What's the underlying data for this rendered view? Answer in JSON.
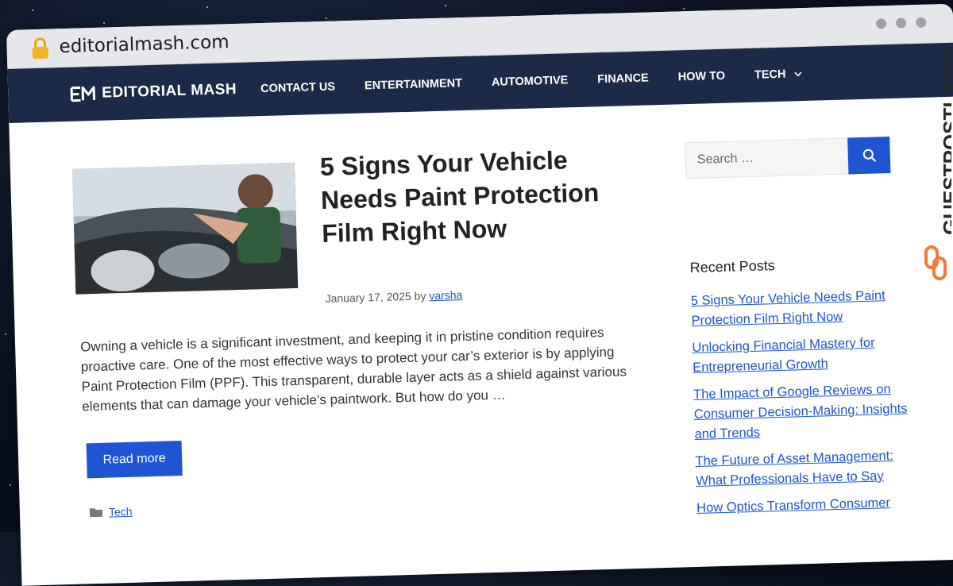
{
  "browser": {
    "url": "editorialmash.com"
  },
  "site": {
    "logo_text": "EDITORIAL MASH",
    "nav": [
      {
        "label": "CONTACT US"
      },
      {
        "label": "ENTERTAINMENT"
      },
      {
        "label": "AUTOMOTIVE"
      },
      {
        "label": "FINANCE"
      },
      {
        "label": "HOW TO"
      },
      {
        "label": "TECH",
        "has_dropdown": true
      }
    ]
  },
  "post": {
    "title": "5 Signs Your Vehicle Needs Paint Protection Film Right Now",
    "date": "January 17, 2025",
    "by": "by",
    "author": "varsha",
    "excerpt": "Owning a vehicle is a significant investment, and keeping it in pristine condition requires proactive care. One of the most effective ways to protect your car’s exterior is by applying Paint Protection Film (PPF). This transparent, durable layer acts as a shield against various elements that can damage your vehicle’s paintwork. But how do you …",
    "read_more": "Read more",
    "category": "Tech"
  },
  "sidebar": {
    "search_placeholder": "Search …",
    "recent_title": "Recent Posts",
    "recent_posts": [
      {
        "title": "5 Signs Your Vehicle Needs Paint Protection Film Right Now"
      },
      {
        "title": "Unlocking Financial Mastery for Entrepreneurial Growth"
      },
      {
        "title": "The Impact of Google Reviews on Consumer Decision-Making: Insights and Trends"
      },
      {
        "title": "The Future of Asset Management: What Professionals Have to Say"
      },
      {
        "title": "How Optics Transform Consumer"
      }
    ]
  },
  "watermark": {
    "text": "GUESTPOSTLINKS"
  },
  "colors": {
    "navbar": "#1b2a48",
    "accent": "#1e55d3",
    "link": "#1e55c8",
    "watermark": "#f07a3a"
  },
  "icons": {
    "lock": "lock-icon",
    "search": "search-icon",
    "folder": "folder-icon",
    "chevron": "chevron-down-icon"
  }
}
